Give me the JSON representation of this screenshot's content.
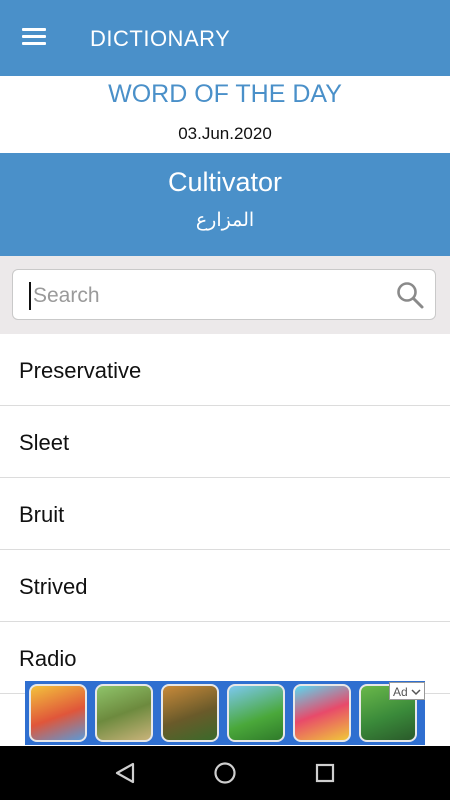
{
  "appbar": {
    "title": "DICTIONARY",
    "menu_icon": "hamburger-menu-icon"
  },
  "word_of_day": {
    "heading": "WORD OF THE DAY",
    "date": "03.Jun.2020",
    "word": "Cultivator",
    "translation": "المزارع"
  },
  "search": {
    "placeholder": "Search",
    "value": "",
    "icon": "search-icon"
  },
  "list": {
    "items": [
      {
        "label": "Preservative"
      },
      {
        "label": "Sleet"
      },
      {
        "label": "Bruit"
      },
      {
        "label": "Strived"
      },
      {
        "label": "Radio"
      }
    ]
  },
  "ad": {
    "badge": "Ad"
  },
  "navbar": {
    "back_icon": "back-icon",
    "home_icon": "home-icon",
    "recents_icon": "recents-icon"
  },
  "colors": {
    "primary": "#4a90c9",
    "search_bg": "#ece9ea",
    "ad_bg": "#2f6fd0",
    "navbar": "#000000"
  }
}
